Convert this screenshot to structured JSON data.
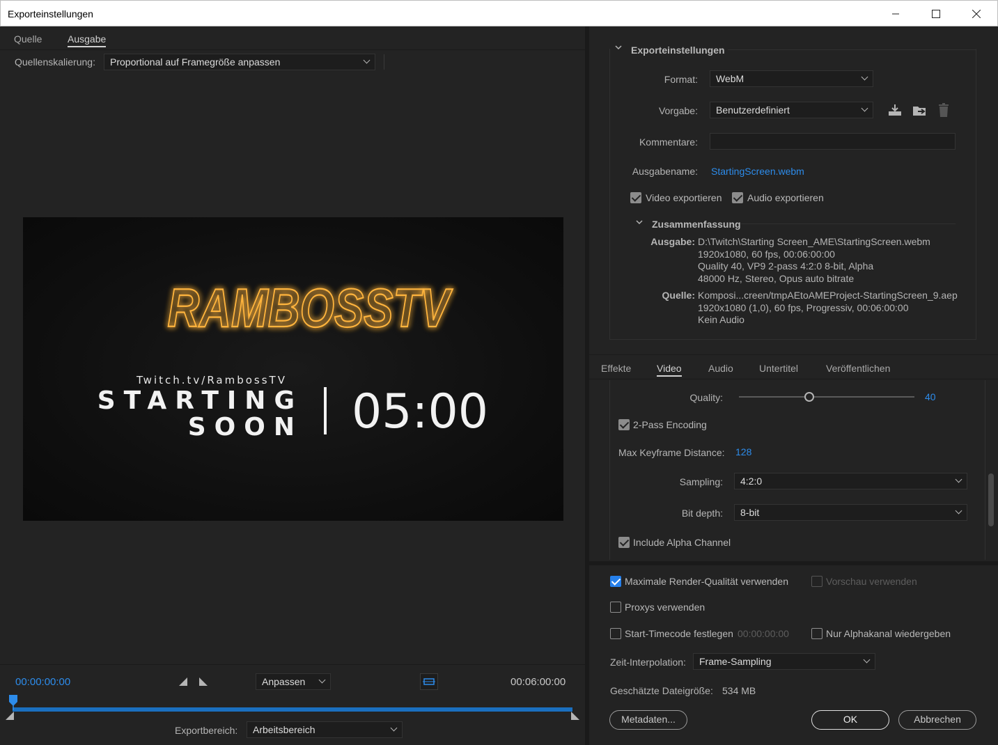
{
  "window": {
    "title": "Exporteinstellungen"
  },
  "left": {
    "tabs": [
      {
        "label": "Quelle"
      },
      {
        "label": "Ausgabe"
      }
    ],
    "scaling_label": "Quellenskalierung:",
    "scaling_value": "Proportional auf Framegröße anpassen",
    "preview": {
      "logo_text": "RAMBOSSTV",
      "twitch_url": "Twitch.tv/RambossTV",
      "starting": "STARTING",
      "soon": "SOON",
      "countdown": "05:00"
    },
    "timeline": {
      "current_time": "00:00:00:00",
      "end_time": "00:06:00:00",
      "fit_value": "Anpassen",
      "playhead_fraction": 0.0
    },
    "export_range_label": "Exportbereich:",
    "export_range_value": "Arbeitsbereich"
  },
  "export_settings": {
    "section_title": "Exporteinstellungen",
    "format_label": "Format:",
    "format_value": "WebM",
    "preset_label": "Vorgabe:",
    "preset_value": "Benutzerdefiniert",
    "comments_label": "Kommentare:",
    "comments_value": "",
    "output_name_label": "Ausgabename:",
    "output_name_value": "StartingScreen.webm",
    "export_video_label": "Video exportieren",
    "export_video_checked": true,
    "export_audio_label": "Audio exportieren",
    "export_audio_checked": true,
    "summary_title": "Zusammenfassung",
    "summary_output_key": "Ausgabe:",
    "summary_output_lines": "D:\\Twitch\\Starting Screen_AME\\StartingScreen.webm\n1920x1080, 60 fps, 00:06:00:00\nQuality 40, VP9 2-pass 4:2:0 8-bit, Alpha\n48000 Hz, Stereo, Opus auto bitrate",
    "summary_source_key": "Quelle:",
    "summary_source_lines": "Komposi...creen/tmpAEtoAMEProject-StartingScreen_9.aep\n1920x1080 (1,0), 60 fps, Progressiv, 00:06:00:00\nKein Audio"
  },
  "settings_tabs": [
    {
      "label": "Effekte"
    },
    {
      "label": "Video"
    },
    {
      "label": "Audio"
    },
    {
      "label": "Untertitel"
    },
    {
      "label": "Veröffentlichen"
    }
  ],
  "video": {
    "quality_label": "Quality:",
    "quality_value": "40",
    "quality_fraction": 0.4,
    "two_pass_label": "2-Pass Encoding",
    "two_pass_checked": true,
    "keyframe_label": "Max Keyframe Distance:",
    "keyframe_value": "128",
    "sampling_label": "Sampling:",
    "sampling_value": "4:2:0",
    "bitdepth_label": "Bit depth:",
    "bitdepth_value": "8-bit",
    "alpha_label": "Include Alpha Channel",
    "alpha_checked": true
  },
  "bottom": {
    "max_render_label": "Maximale Render-Qualität verwenden",
    "max_render_checked": true,
    "preview_label": "Vorschau verwenden",
    "preview_checked": false,
    "proxies_label": "Proxys verwenden",
    "proxies_checked": false,
    "start_tc_label": "Start-Timecode festlegen",
    "start_tc_value": "00:00:00:00",
    "start_tc_checked": false,
    "alpha_only_label": "Nur Alphakanal wiedergeben",
    "alpha_only_checked": false,
    "interp_label": "Zeit-Interpolation:",
    "interp_value": "Frame-Sampling",
    "filesize_label": "Geschätzte Dateigröße:",
    "filesize_value": "534 MB",
    "metadata_button": "Metadaten...",
    "ok_button": "OK",
    "cancel_button": "Abbrechen"
  },
  "colors": {
    "accent": "#2d8ceb",
    "panel": "#232323",
    "logo": "#f2a93b"
  }
}
